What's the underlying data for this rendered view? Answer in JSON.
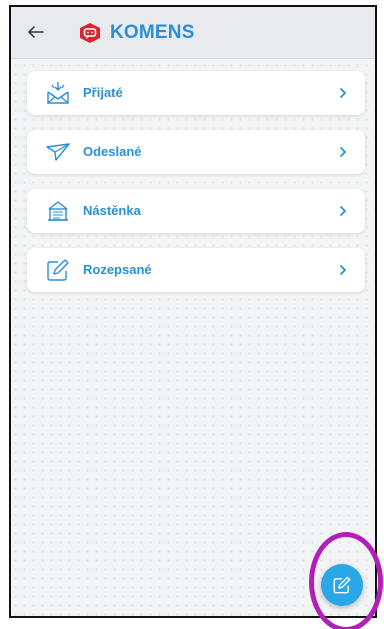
{
  "header": {
    "title": "KOMENS",
    "back_icon": "arrow-left-icon",
    "logo_icon": "komens-logo-icon",
    "title_color": "#2a8fd6",
    "logo_color": "#d9262e"
  },
  "menu": {
    "items": [
      {
        "label": "Přijaté",
        "icon": "inbox-envelope-icon"
      },
      {
        "label": "Odeslané",
        "icon": "paper-plane-icon"
      },
      {
        "label": "Nástěnka",
        "icon": "noticeboard-icon"
      },
      {
        "label": "Rozepsané",
        "icon": "draft-edit-icon"
      }
    ],
    "accent_color": "#2a8fd6"
  },
  "fab": {
    "icon": "compose-icon",
    "color": "#2aa7e6"
  },
  "annotation": {
    "highlight_color": "#b11fb8"
  }
}
